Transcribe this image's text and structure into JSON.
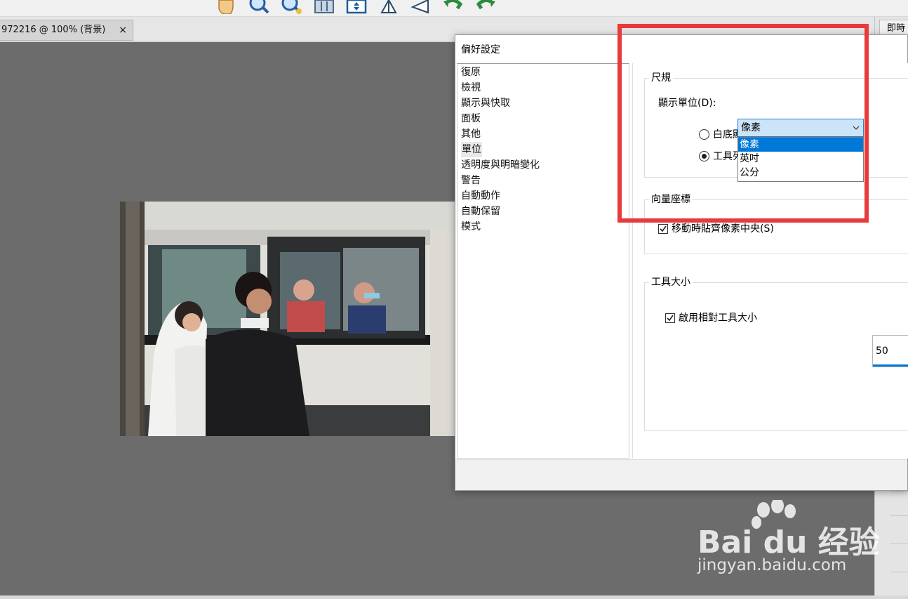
{
  "toolbar": {
    "icons": [
      "hand-tool-icon",
      "zoom-in-icon",
      "zoom-out-icon",
      "actual-pixels-icon",
      "fit-screen-icon",
      "rotate-icon",
      "flip-icon",
      "undo-icon",
      "redo-icon"
    ]
  },
  "document_tab": {
    "label": "972216 @ 100% (背景)",
    "close": "×"
  },
  "right_panel": {
    "tab_label": "即時"
  },
  "dialog": {
    "title": "偏好設定",
    "categories": [
      {
        "label": "復原",
        "selected": false
      },
      {
        "label": "檢視",
        "selected": false
      },
      {
        "label": "顯示與快取",
        "selected": false
      },
      {
        "label": "面板",
        "selected": false
      },
      {
        "label": "其他",
        "selected": false
      },
      {
        "label": "單位",
        "selected": true
      },
      {
        "label": "透明度與明暗變化",
        "selected": false
      },
      {
        "label": "警告",
        "selected": false
      },
      {
        "label": "自動動作",
        "selected": false
      },
      {
        "label": "自動保留",
        "selected": false
      },
      {
        "label": "模式",
        "selected": false
      }
    ],
    "ruler_group": {
      "title": "尺規",
      "unit_label": "顯示單位(D):",
      "unit_value": "像素",
      "unit_options": [
        "像素",
        "英吋",
        "公分"
      ],
      "radio_white": "白底顯",
      "radio_toolbar": "工具列色彩(T)",
      "radio_toolbar_checked": true
    },
    "vector_group": {
      "title": "向量座標",
      "snap_label": "移動時貼齊像素中央(S)",
      "snap_checked": true
    },
    "tool_size_group": {
      "title": "工具大小",
      "relative_label": "啟用相對工具大小",
      "relative_checked": true,
      "size_value": "50"
    }
  },
  "watermark": {
    "brand": "Bai du 经验",
    "url": "jingyan.baidu.com"
  },
  "colors": {
    "highlight": "#e83a3a",
    "select_bg": "#cce4f7",
    "selected_option": "#0078d7",
    "canvas_bg": "#6c6c6c"
  }
}
